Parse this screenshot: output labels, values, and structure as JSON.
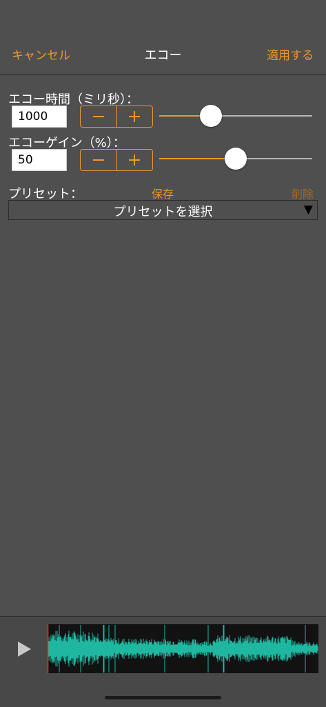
{
  "nav": {
    "cancel_label": "キャンセル",
    "title": "エコー",
    "apply_label": "適用する"
  },
  "echo_time": {
    "label": "エコー時間（ミリ秒）：",
    "value": "1000",
    "slider_fraction": 0.34
  },
  "echo_gain": {
    "label": "エコーゲイン（%）：",
    "value": "50",
    "slider_fraction": 0.5
  },
  "stepper": {
    "minus_icon": "minus-icon",
    "plus_icon": "plus-icon"
  },
  "preset": {
    "label": "プリセット：",
    "save_label": "保存",
    "delete_label": "削除",
    "select_value": "プリセットを選択",
    "select_arrow": "▼"
  },
  "player": {
    "play_icon": "play-icon"
  },
  "colors": {
    "background": "#4f4f4f",
    "accent": "#f0982a",
    "accent_disabled": "#a36a25",
    "waveform": "#1fb7a0",
    "waveform_background": "#121212",
    "playhead": "#e0402a"
  }
}
